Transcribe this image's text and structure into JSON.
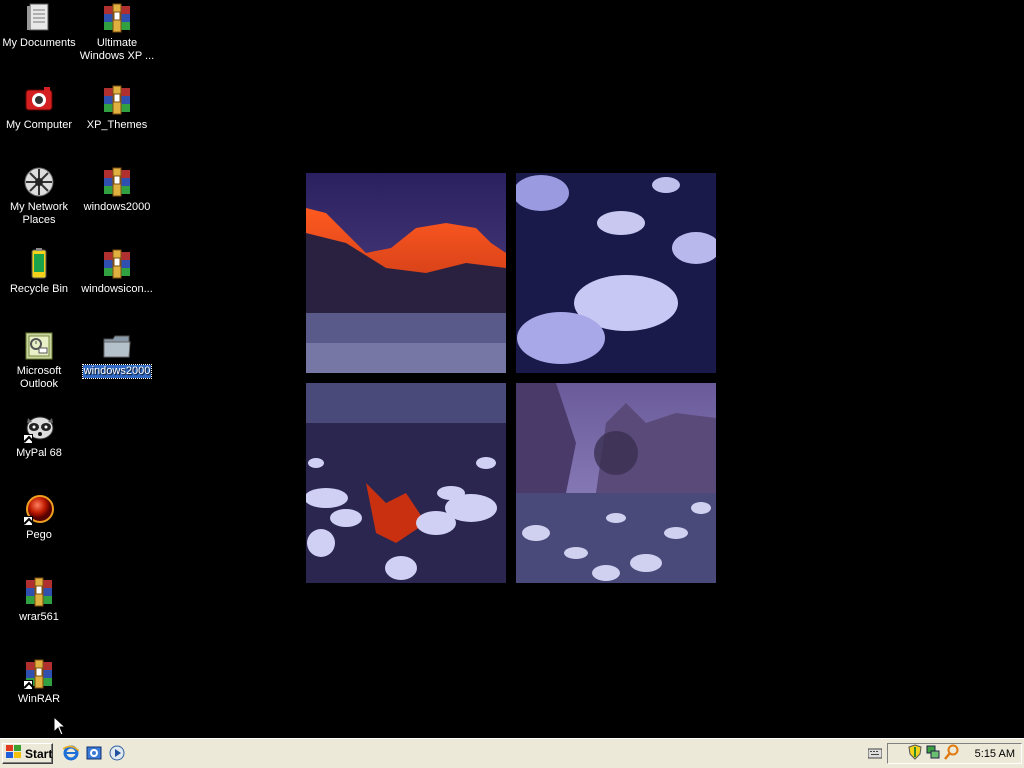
{
  "desktop_icons": [
    {
      "label": "My Documents",
      "icon": "my-documents-icon"
    },
    {
      "label": "Ultimate Windows XP ...",
      "icon": "winrar-archive-icon"
    },
    {
      "label": "My Computer",
      "icon": "my-computer-icon"
    },
    {
      "label": "XP_Themes",
      "icon": "winrar-archive-icon"
    },
    {
      "label": "My Network Places",
      "icon": "network-places-icon"
    },
    {
      "label": "windows2000",
      "icon": "winrar-archive-icon"
    },
    {
      "label": "Recycle Bin",
      "icon": "recycle-bin-icon"
    },
    {
      "label": "windowsicon...",
      "icon": "winrar-archive-icon"
    },
    {
      "label": "Microsoft Outlook",
      "icon": "outlook-icon"
    },
    {
      "label": "windows2000",
      "icon": "folder-icon",
      "selected": true
    },
    {
      "label": "MyPal 68",
      "icon": "mypal-icon",
      "shortcut": true
    },
    {
      "label": "Pego",
      "icon": "pego-icon",
      "shortcut": true
    },
    {
      "label": "wrar561",
      "icon": "winrar-archive-icon"
    },
    {
      "label": "WinRAR",
      "icon": "winrar-archive-icon",
      "shortcut": true
    }
  ],
  "taskbar": {
    "start_label": "Start",
    "quick_launch": [
      "internet-explorer-icon",
      "outlook-express-icon",
      "media-player-icon"
    ],
    "tray_icons": [
      "keyboard-icon",
      "security-shield-icon",
      "network-icon",
      "search-icon"
    ],
    "clock": "5:15 AM"
  },
  "colors": {
    "desktop_bg": "#000000",
    "taskbar_bg": "#ece9d8",
    "selection": "#316ac5"
  }
}
